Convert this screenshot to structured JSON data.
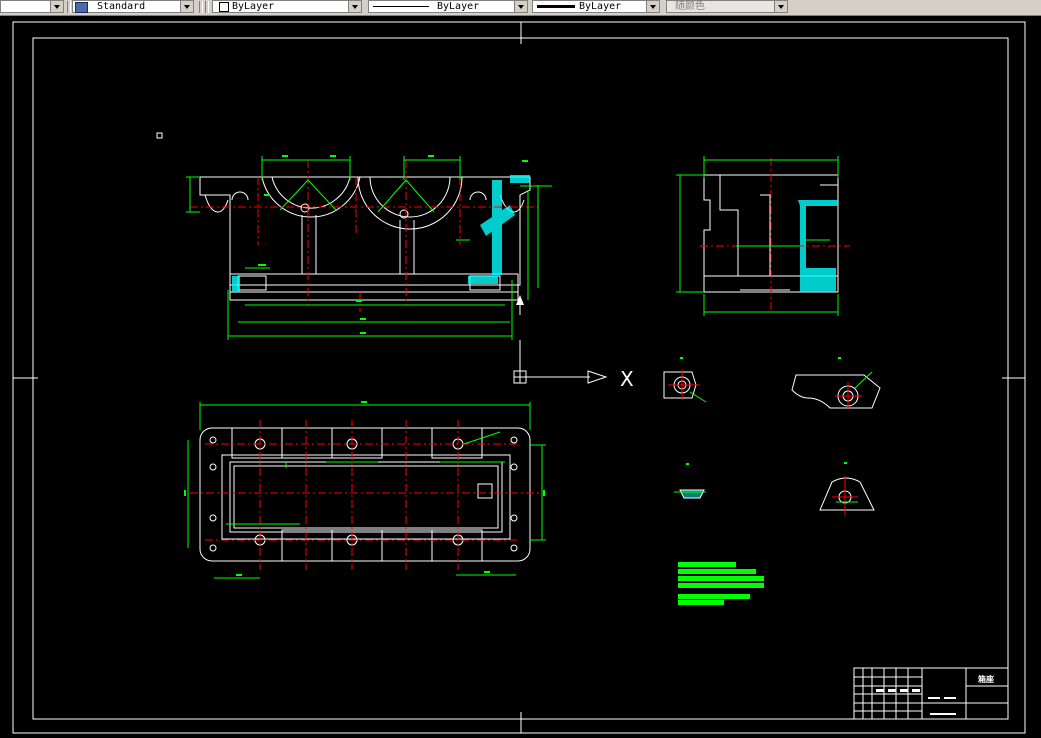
{
  "toolbar": {
    "text_style": "Standard",
    "layer_control": "ByLayer",
    "linetype_control": "ByLayer",
    "lineweight_control": "ByLayer",
    "plot_style": "随颜色"
  },
  "drawing": {
    "ucs_x_label": "X",
    "title_block_title": "箱座"
  },
  "colors": {
    "background": "#000000",
    "geometry": "#ffffff",
    "dimensions": "#00ff00",
    "centerlines": "#ff0000",
    "hatch": "#00ffff"
  }
}
